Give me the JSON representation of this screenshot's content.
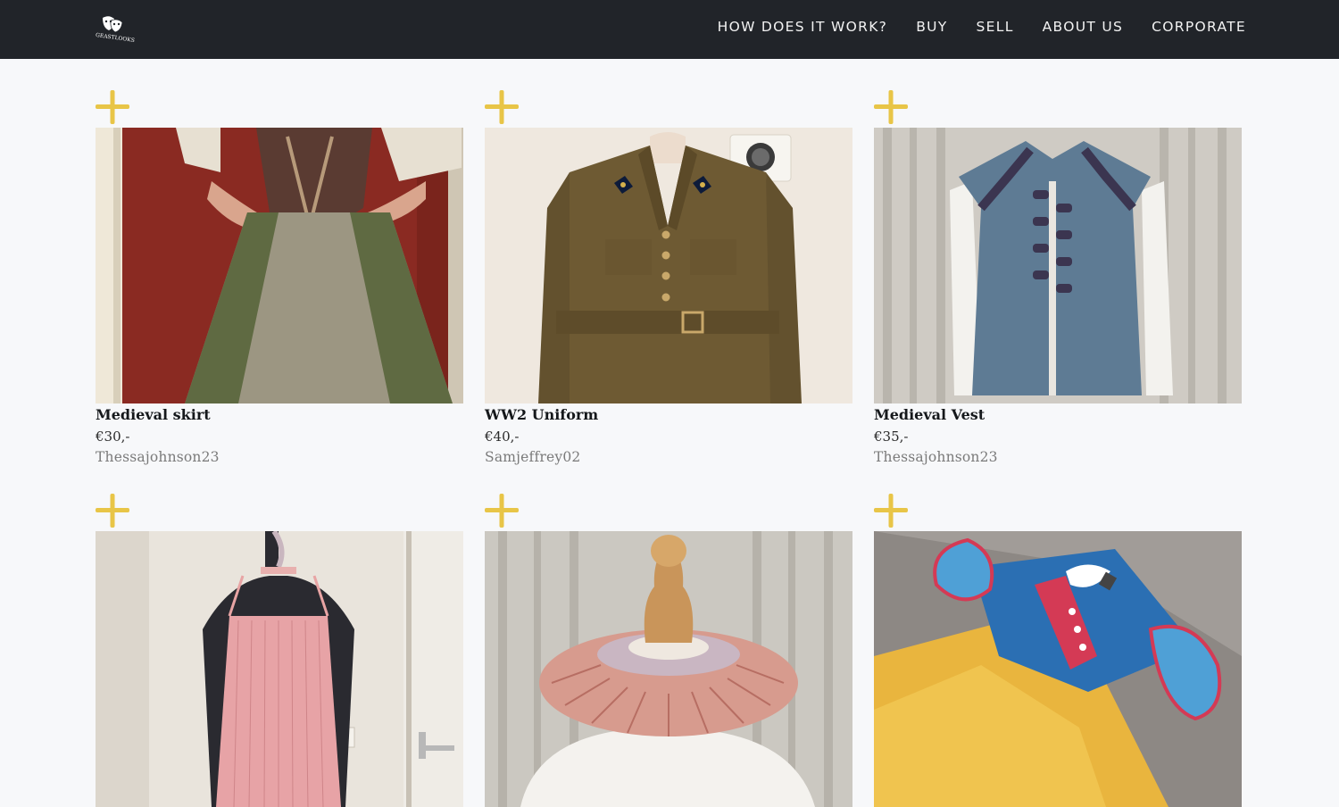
{
  "header": {
    "logo_icon": "theatre-masks-logo",
    "logo_text": "GEASTLOOKS",
    "nav": [
      {
        "label": "HOW DOES IT WORK?"
      },
      {
        "label": "BUY"
      },
      {
        "label": "SELL"
      },
      {
        "label": "ABOUT US"
      },
      {
        "label": "CORPORATE"
      }
    ]
  },
  "colors": {
    "header_bg": "#212429",
    "accent_plus": "#e8c547",
    "page_bg": "#f7f8fa"
  },
  "products": [
    {
      "title": "Medieval skirt",
      "price": "€30,-",
      "seller": "Thessajohnson23",
      "add_icon": "plus-icon"
    },
    {
      "title": "WW2 Uniform",
      "price": "€40,-",
      "seller": "Samjeffrey02",
      "add_icon": "plus-icon"
    },
    {
      "title": "Medieval Vest",
      "price": "€35,-",
      "seller": "Thessajohnson23",
      "add_icon": "plus-icon"
    },
    {
      "title": "",
      "price": "",
      "seller": "",
      "add_icon": "plus-icon"
    },
    {
      "title": "",
      "price": "",
      "seller": "",
      "add_icon": "plus-icon"
    },
    {
      "title": "",
      "price": "",
      "seller": "",
      "add_icon": "plus-icon"
    }
  ]
}
